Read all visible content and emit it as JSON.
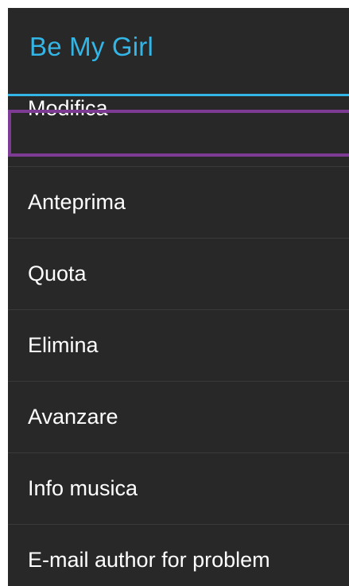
{
  "dialog": {
    "title": "Be My Girl",
    "accent_color": "#33b5e5",
    "background_color": "#282828",
    "focus_color": "#7e3b96"
  },
  "menu": {
    "items": [
      {
        "label": "Modifica",
        "focused": true
      },
      {
        "label": "Anteprima",
        "focused": false
      },
      {
        "label": "Quota",
        "focused": false
      },
      {
        "label": "Elimina",
        "focused": false
      },
      {
        "label": "Avanzare",
        "focused": false
      },
      {
        "label": "Info musica",
        "focused": false
      },
      {
        "label": "E-mail author for problem",
        "focused": false
      }
    ]
  }
}
